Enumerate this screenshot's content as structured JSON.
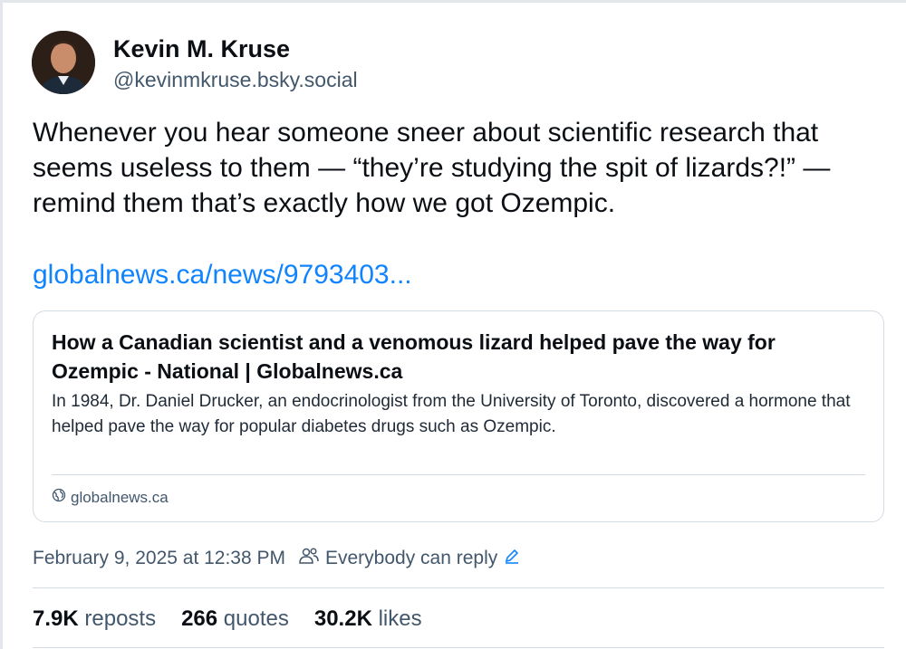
{
  "author": {
    "name": "Kevin M. Kruse",
    "handle": "@kevinmkruse.bsky.social"
  },
  "post": {
    "text": "Whenever you hear someone sneer about scientific research that seems useless to them — “they’re studying the spit of lizards?!” — remind them that’s exactly how we got Ozempic.",
    "link_text": "globalnews.ca/news/9793403..."
  },
  "card": {
    "title": "How a Canadian scientist and a venomous lizard helped pave the way for Ozempic - National | Globalnews.ca",
    "description": "In 1984, Dr. Daniel Drucker, an endocrinologist from the University of Toronto, discovered a hormone that helped pave the way for popular diabetes drugs such as Ozempic.",
    "domain": "globalnews.ca"
  },
  "meta": {
    "timestamp": "February 9, 2025 at 12:38 PM",
    "reply_setting": "Everybody can reply"
  },
  "stats": {
    "reposts_count": "7.9K",
    "reposts_label": "reposts",
    "quotes_count": "266",
    "quotes_label": "quotes",
    "likes_count": "30.2K",
    "likes_label": "likes"
  },
  "colors": {
    "link": "#1083fe",
    "muted": "#42576c",
    "border": "#d4dbe2"
  },
  "icons": {
    "globe": "globe-icon",
    "people": "people-icon",
    "edit": "pencil-icon"
  }
}
